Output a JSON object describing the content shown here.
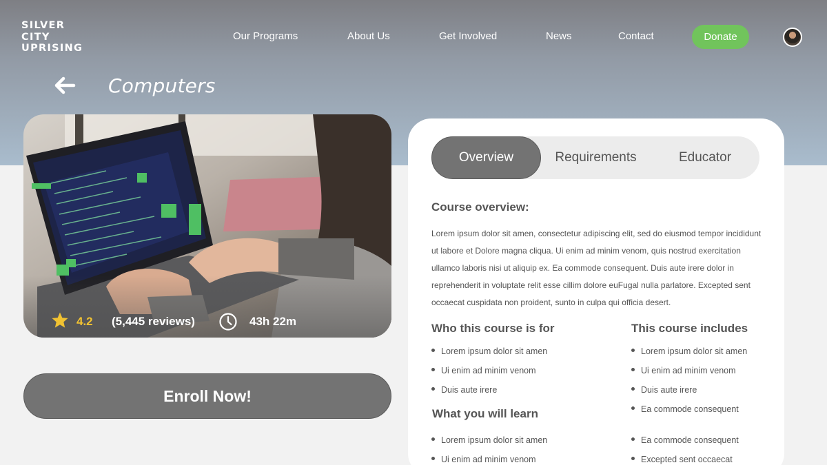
{
  "header": {
    "logo_lines": [
      "SILVER",
      "CITY",
      "UPRISING"
    ],
    "nav": [
      "Our Programs",
      "About Us",
      "Get Involved",
      "News",
      "Contact"
    ],
    "donate_label": "Donate",
    "avatar_icon": "user-avatar"
  },
  "page": {
    "title": "Computers",
    "back_icon": "arrow-left-icon"
  },
  "course_card": {
    "rating": "4.2",
    "reviews": "(5,445 reviews)",
    "duration": "43h 22m",
    "star_color": "#f1c232"
  },
  "enroll_label": "Enroll Now!",
  "tabs": [
    {
      "label": "Overview",
      "active": true
    },
    {
      "label": "Requirements",
      "active": false
    },
    {
      "label": "Educator",
      "active": false
    }
  ],
  "overview": {
    "heading": "Course overview:",
    "text": "Lorem ipsum dolor sit amen, consectetur adipiscing elit, sed do eiusmod tempor incididunt ut labore et Dolore magna cliqua. Ui enim ad minim venom, quis nostrud exercitation ullamco laboris nisi ut aliquip ex. Ea commode consequent. Duis aute irere dolor in reprehenderit in voluptate relit esse cillim dolore euFugal nulla parlatore. Excepted sent occaecat cuspidata non proident, sunto in culpa qui officia desert."
  },
  "who_for": {
    "heading": "Who this course is for",
    "items": [
      "Lorem ipsum dolor sit amen",
      "Ui enim ad minim venom",
      "Duis aute irere"
    ]
  },
  "includes": {
    "heading": "This course includes",
    "items": [
      "Lorem ipsum dolor sit amen",
      "Ui enim ad minim venom",
      "Duis aute irere",
      "Ea commode consequent"
    ]
  },
  "learn": {
    "heading": "What you will learn",
    "left_items": [
      "Lorem ipsum dolor sit amen",
      "Ui enim ad minim venom"
    ],
    "right_items": [
      "Ea commode consequent",
      "Excepted sent occaecat"
    ]
  },
  "colors": {
    "accent_green": "#71c45c",
    "button_gray": "#737373"
  }
}
